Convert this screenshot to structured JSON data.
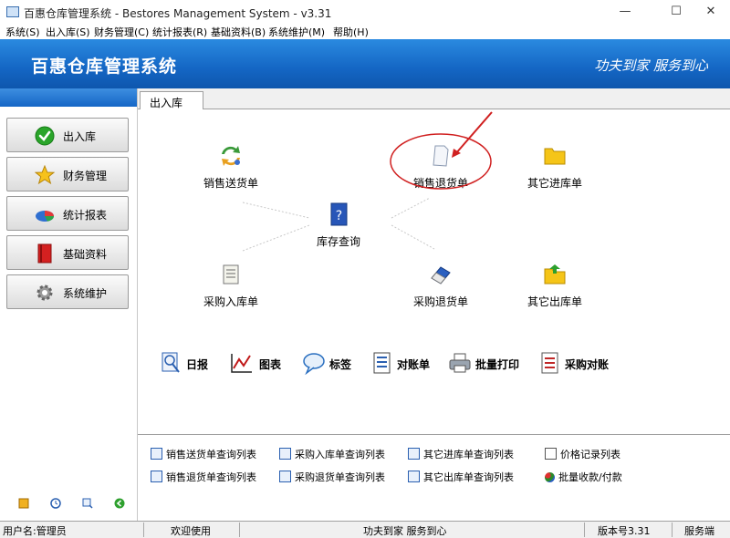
{
  "window": {
    "title": "百惠仓库管理系统 - Bestores Management System - v3.31",
    "minimize": "—",
    "maximize": "☐",
    "close": "✕"
  },
  "menu": [
    "系统(S)",
    "出入库(S)",
    "财务管理(C)",
    "统计报表(R)",
    "基础资料(B)",
    "系统维护(M)",
    "帮助(H)"
  ],
  "banner": {
    "title": "百惠仓库管理系统",
    "slogan": "功夫到家  服务到心"
  },
  "sidebar": {
    "items": [
      {
        "label": "出入库",
        "icon": "check-icon"
      },
      {
        "label": "财务管理",
        "icon": "star-icon"
      },
      {
        "label": "统计报表",
        "icon": "pie-chart-icon"
      },
      {
        "label": "基础资料",
        "icon": "book-icon"
      },
      {
        "label": "系统维护",
        "icon": "gear-icon"
      }
    ],
    "bottom_icons": [
      "key-icon",
      "clock-icon",
      "search-icon",
      "back-arrow-icon"
    ]
  },
  "tab": {
    "label": "出入库"
  },
  "flow": {
    "sales_delivery": "销售送货单",
    "sales_return": "销售退货单",
    "other_in": "其它进库单",
    "inventory_query": "库存查询",
    "purchase_in": "采购入库单",
    "purchase_return": "采购退货单",
    "other_out": "其它出库单"
  },
  "quick": {
    "daily": "日报",
    "chart": "图表",
    "tag": "标签",
    "statement": "对账单",
    "batch_print": "批量打印",
    "purchase_reconcile": "采购对账"
  },
  "links": {
    "row1": [
      "销售送货单查询列表",
      "采购入库单查询列表",
      "其它进库单查询列表",
      "价格记录列表"
    ],
    "row2": [
      "销售退货单查询列表",
      "采购退货单查询列表",
      "其它出库单查询列表",
      "批量收款/付款"
    ]
  },
  "status": {
    "user": "用户名:管理员",
    "welcome": "欢迎使用",
    "slogan": "功夫到家 服务到心",
    "version": "版本号3.31",
    "mode": "服务端"
  },
  "colors": {
    "banner": "#1466c4",
    "accent_red": "#d02020",
    "link_text": "#000000"
  }
}
